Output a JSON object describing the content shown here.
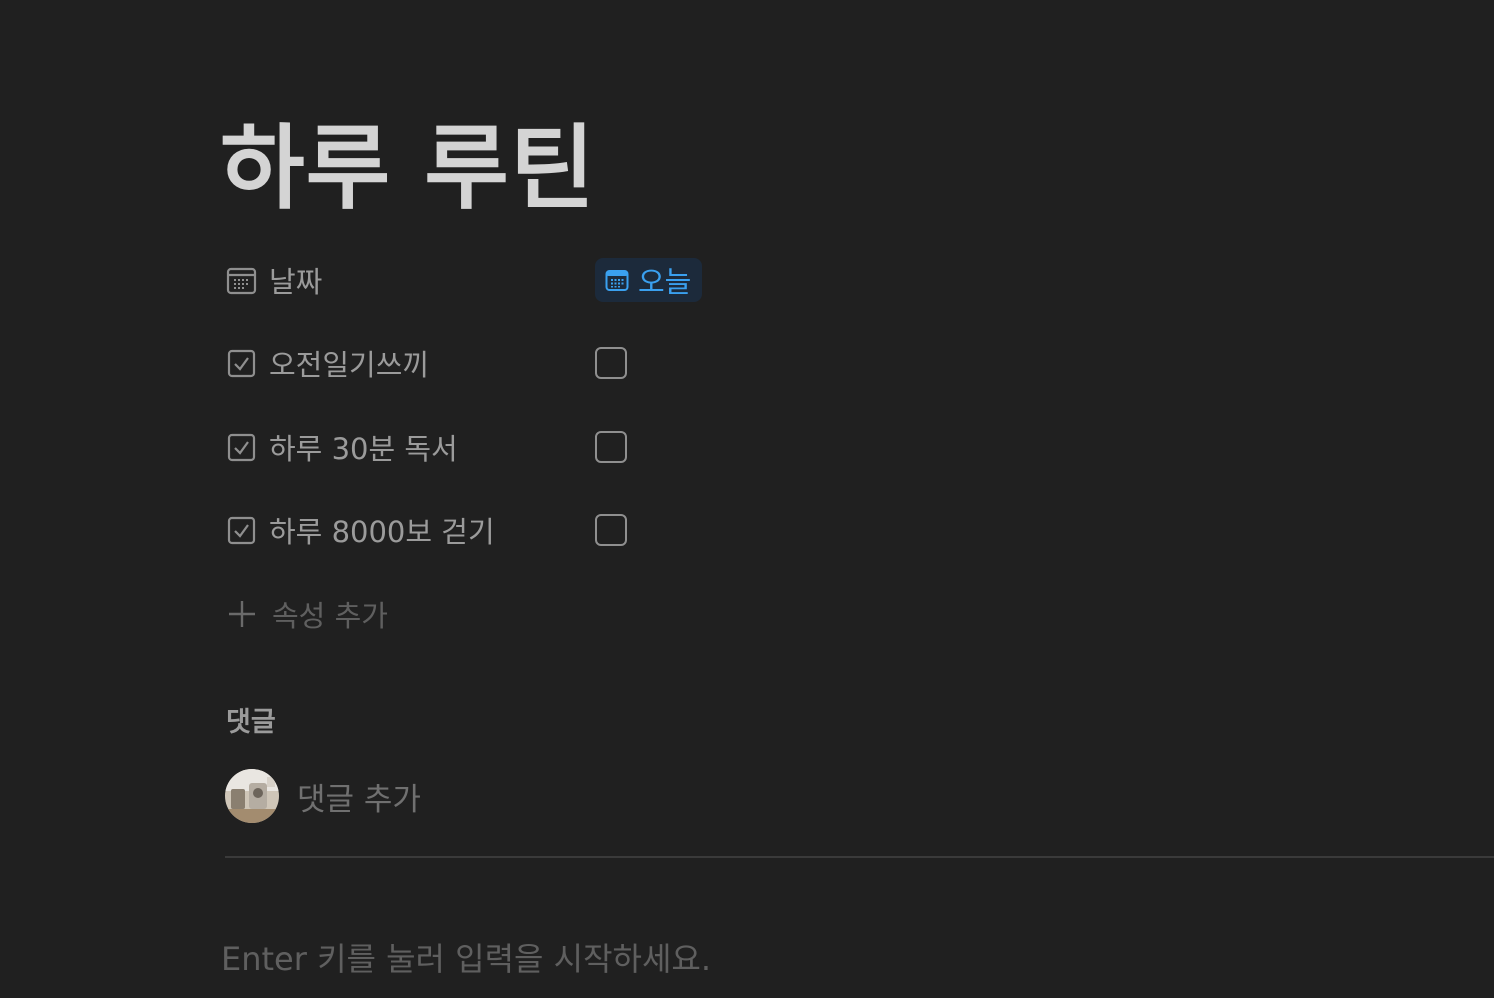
{
  "page": {
    "title": "하루 루틴"
  },
  "properties": [
    {
      "name": "날짜",
      "type": "date",
      "icon": "calendar-icon",
      "value": "오늘"
    },
    {
      "name": "오전일기쓰끼",
      "type": "checkbox",
      "icon": "checkbox-property-icon",
      "checked": false
    },
    {
      "name": "하루 30분 독서",
      "type": "checkbox",
      "icon": "checkbox-property-icon",
      "checked": false
    },
    {
      "name": "하루 8000보 걷기",
      "type": "checkbox",
      "icon": "checkbox-property-icon",
      "checked": false
    }
  ],
  "add_property_label": "속성 추가",
  "comments": {
    "heading": "댓글",
    "input_placeholder": "댓글 추가"
  },
  "body_placeholder": "Enter 키를 눌러 입력을 시작하세요.",
  "colors": {
    "background": "#202020",
    "title": "#d4d4d4",
    "muted_text": "#9b9b9b",
    "date_chip_bg": "#1c2a3b",
    "date_chip_text": "#3aa0ef"
  }
}
